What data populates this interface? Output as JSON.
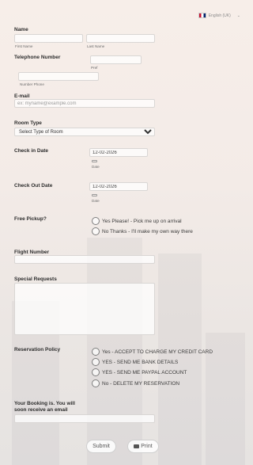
{
  "language": {
    "selected": "English (UK)"
  },
  "name": {
    "label": "Name",
    "first_sub": "First Name",
    "last_sub": "Last Name",
    "first_value": "",
    "last_value": ""
  },
  "phone": {
    "label": "Telephone Number",
    "pref_sub": "Pref",
    "number_sub": "Number Phone"
  },
  "email": {
    "label": "E-mail",
    "placeholder": "ex: myname@example.com"
  },
  "room": {
    "label": "Room Type",
    "selected": "Select Type of Room"
  },
  "checkin": {
    "label": "Check in Date",
    "value": "12-02-2026",
    "sub": "Date"
  },
  "checkout": {
    "label": "Check Out Date",
    "value": "12-02-2026",
    "sub": "Date"
  },
  "pickup": {
    "label": "Free Pickup?",
    "options": [
      "Yes Please! - Pick me up on arrival",
      "No Thanks - I'll make my own way there"
    ]
  },
  "flight": {
    "label": "Flight Number"
  },
  "requests": {
    "label": "Special Requests"
  },
  "policy": {
    "label": "Reservation Policy",
    "options": [
      "Yes - ACCEPT TO CHARGE MY CREDIT CARD",
      "YES - SEND ME BANK DETAILS",
      "YES - SEND ME PAYPAL ACCOUNT",
      "No - DELETE MY RESERVATION"
    ]
  },
  "booking": {
    "label_line1": "Your Booking is. You will",
    "label_line2": "soon receive an email"
  },
  "buttons": {
    "submit": "Submit",
    "print": "Print"
  },
  "icons": {
    "flag": "uk-flag-icon",
    "chevron": "chevron-down-icon",
    "calendar": "calendar-icon",
    "printer": "printer-icon"
  }
}
